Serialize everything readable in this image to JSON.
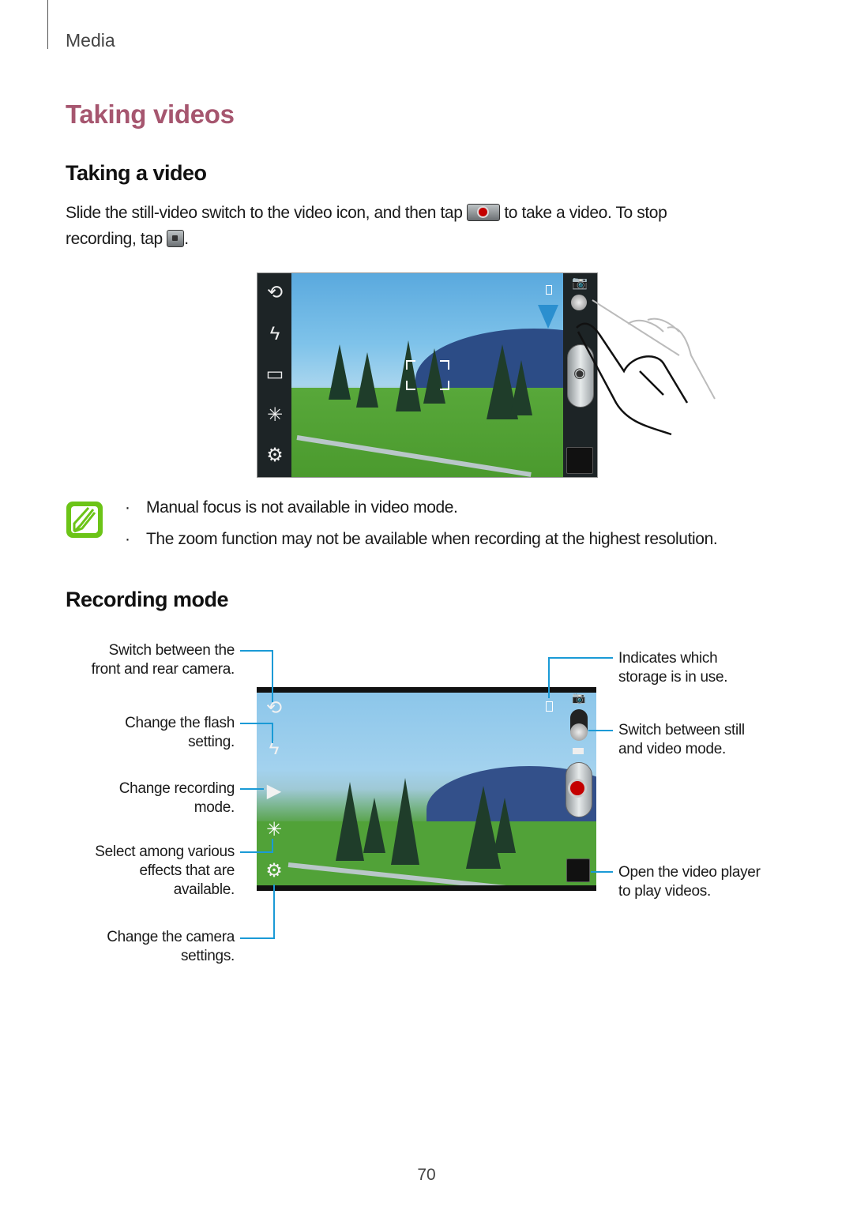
{
  "header": {
    "section": "Media"
  },
  "page_title": "Taking videos",
  "taking_a_video": {
    "heading": "Taking a video",
    "text_part1": "Slide the still-video switch to the video icon, and then tap",
    "record_icon": "record-button-icon",
    "text_part2": "to take a video. To stop",
    "text_part3": "recording, tap",
    "stop_icon": "stop-button-icon",
    "text_part4": "."
  },
  "screenshot1": {
    "left_icons": [
      "switch-camera-icon",
      "flash-off-icon",
      "recording-mode-icon",
      "effects-icon",
      "settings-icon"
    ],
    "right_icons": [
      "storage-phone-icon",
      "camera-mode-icon",
      "mode-switch-slider",
      "shutter-camera-icon",
      "gallery-thumbnail"
    ],
    "gesture": "swipe-down-hand-icon"
  },
  "note": {
    "icon": "note-pencil-icon",
    "bullets": [
      "Manual focus is not available in video mode.",
      "The zoom function may not be available when recording at the highest resolution."
    ]
  },
  "recording_mode": {
    "heading": "Recording mode",
    "callouts_left": [
      {
        "line1": "Switch between the",
        "line2": "front and rear camera."
      },
      {
        "line1": "Change the flash",
        "line2": "setting."
      },
      {
        "line1": "Change recording",
        "line2": "mode."
      },
      {
        "line1": "Select among various",
        "line2": "effects that are",
        "line3": "available."
      },
      {
        "line1": "Change the camera",
        "line2": "settings."
      }
    ],
    "callouts_right": [
      {
        "line1": "Indicates which",
        "line2": "storage is in use."
      },
      {
        "line1": "Switch between still",
        "line2": "and video mode."
      },
      {
        "line1": "Open the video player",
        "line2": "to play videos."
      }
    ]
  },
  "page_number": "70",
  "colors": {
    "title": "#a6566f",
    "callout_line": "#1a9ad6",
    "note_icon": "#6cc417",
    "record": "#c40000"
  }
}
